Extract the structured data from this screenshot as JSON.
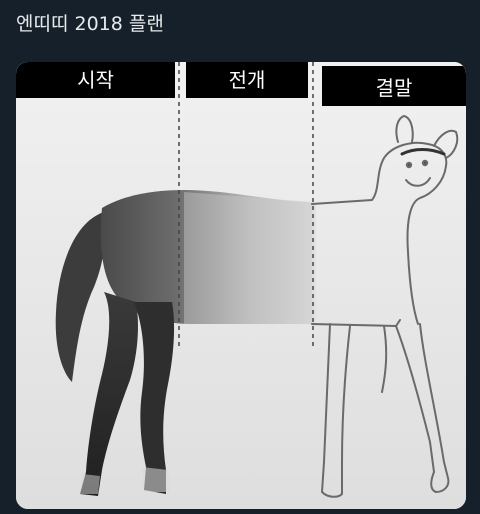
{
  "tweet": {
    "text": "엔띠띠 2018 플랜"
  },
  "meme": {
    "stages": {
      "start": "시작",
      "middle": "전개",
      "end": "결말"
    }
  }
}
